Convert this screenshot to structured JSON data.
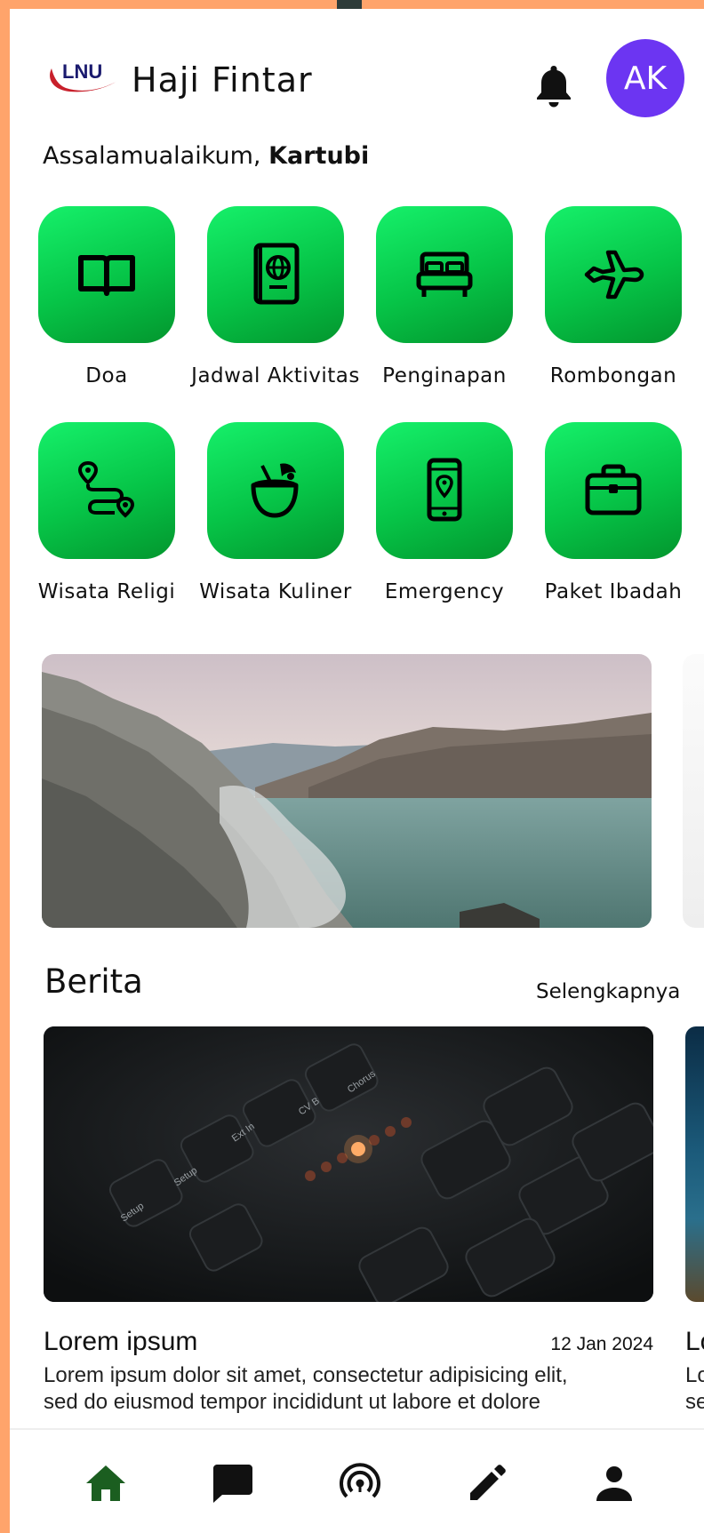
{
  "header": {
    "logo_text": "LNU",
    "app_title": "Haji Fintar",
    "avatar_initials": "AK"
  },
  "greeting": {
    "prefix": "Assalamualaikum, ",
    "name": "Kartubi"
  },
  "menu": [
    {
      "label": "Doa",
      "icon": "book-icon"
    },
    {
      "label": "Jadwal Aktivitas",
      "icon": "passport-icon"
    },
    {
      "label": "Penginapan",
      "icon": "bed-icon"
    },
    {
      "label": "Rombongan",
      "icon": "airplane-icon"
    },
    {
      "label": "Wisata Religi",
      "icon": "route-icon"
    },
    {
      "label": "Wisata Kuliner",
      "icon": "coconut-drink-icon"
    },
    {
      "label": "Emergency",
      "icon": "phone-location-icon"
    },
    {
      "label": "Paket Ibadah",
      "icon": "briefcase-icon"
    }
  ],
  "news_section": {
    "title": "Berita",
    "more": "Selengkapnya"
  },
  "news": [
    {
      "title": "Lorem ipsum",
      "date": "12 Jan 2024",
      "desc_line1": "Lorem ipsum dolor sit amet, consectetur adipisicing elit,",
      "desc_line2": "sed do eiusmod tempor incididunt ut labore et dolore"
    },
    {
      "title_peek": "Lo",
      "desc_peek1": "Lo",
      "desc_peek2": "se"
    }
  ],
  "bottom_nav": [
    {
      "name": "home",
      "icon": "home-icon",
      "active": true
    },
    {
      "name": "chat",
      "icon": "chat-icon",
      "active": false
    },
    {
      "name": "broadcast",
      "icon": "broadcast-icon",
      "active": false
    },
    {
      "name": "edit",
      "icon": "pencil-icon",
      "active": false
    },
    {
      "name": "profile",
      "icon": "person-icon",
      "active": false
    }
  ],
  "colors": {
    "accent_green": "#06c447",
    "avatar_purple": "#6c35f2",
    "nav_active": "#1b5e20",
    "outer_frame": "#ffa46b"
  }
}
